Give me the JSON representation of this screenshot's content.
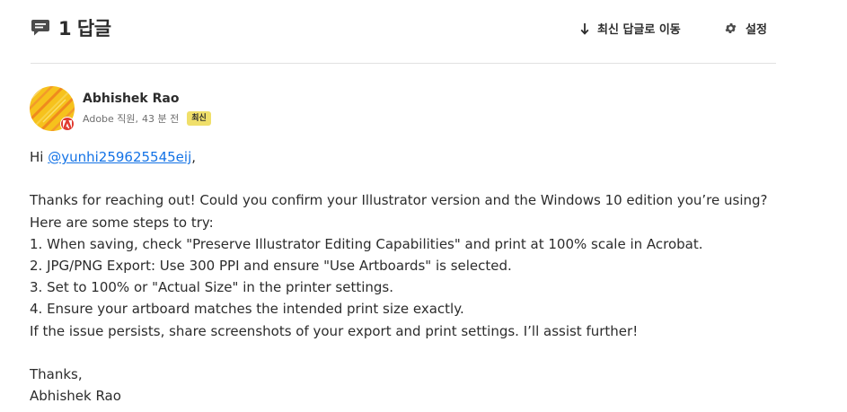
{
  "header": {
    "reply_count": "1 답글",
    "jump_to_latest": "최신 답글로 이동",
    "settings": "설정"
  },
  "author": {
    "name": "Abhishek Rao",
    "role": "Adobe 직원,",
    "time": "43 분 전",
    "badge": "최신"
  },
  "message": {
    "greeting_prefix": "Hi ",
    "mention": "@yunhi259625545eij",
    "greeting_suffix": ",",
    "lines": [
      "Thanks for reaching out! Could you confirm your Illustrator version and the Windows 10 edition you’re using?",
      "Here are some steps to try:",
      "1. When saving, check \"Preserve Illustrator Editing Capabilities\" and print at 100% scale in Acrobat.",
      "2. JPG/PNG Export: Use 300 PPI and ensure \"Use Artboards\" is selected.",
      "3. Set to 100% or \"Actual Size\" in the printer settings.",
      "4. Ensure your artboard matches the intended print size exactly.",
      "If the issue persists, share screenshots of your export and print settings. I’ll assist further!"
    ],
    "signoff": "Thanks,",
    "signature": "Abhishek Rao"
  },
  "icons": {
    "reply": "comment-icon",
    "jump": "arrow-down-icon",
    "settings": "gear-icon",
    "staff": "adobe-logo-icon"
  },
  "colors": {
    "link": "#1473e6",
    "new_badge": "#f0df6a",
    "adobe_red": "#e03a2f",
    "avatar_yellow": "#f6c21c",
    "avatar_orange": "#ef8a1e"
  }
}
